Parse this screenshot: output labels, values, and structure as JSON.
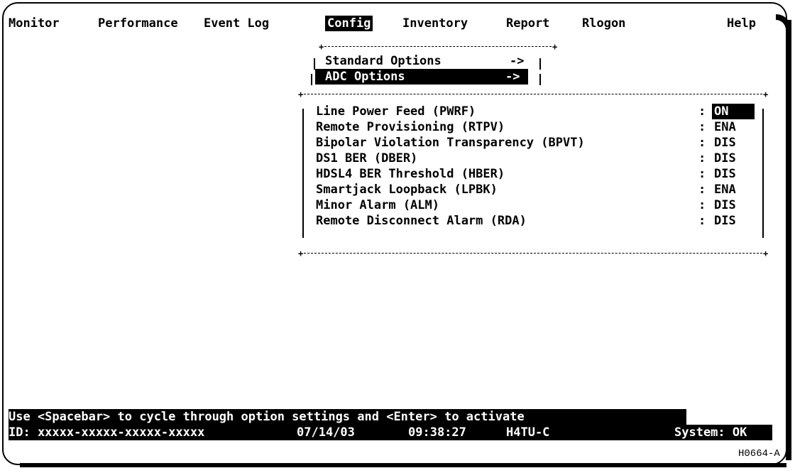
{
  "menubar": {
    "items": [
      "Monitor",
      "Performance",
      "Event Log",
      "Config",
      "Inventory",
      "Report",
      "Rlogon"
    ],
    "help": "Help",
    "active": "Config"
  },
  "submenu": {
    "items": [
      {
        "label": "Standard Options",
        "arrow": "->"
      },
      {
        "label": "ADC Options",
        "arrow": "->"
      }
    ],
    "selected_index": 1
  },
  "options": {
    "rows": [
      {
        "label": "Line Power Feed (PWRF)",
        "value": "ON",
        "selected": true
      },
      {
        "label": "Remote Provisioning (RTPV)",
        "value": "ENA"
      },
      {
        "label": "Bipolar Violation Transparency (BPVT)",
        "value": "DIS"
      },
      {
        "label": "DS1 BER (DBER)",
        "value": "DIS"
      },
      {
        "label": "HDSL4 BER Threshold (HBER)",
        "value": "DIS"
      },
      {
        "label": "Smartjack Loopback (LPBK)",
        "value": "ENA"
      },
      {
        "label": "Minor Alarm (ALM)",
        "value": "DIS"
      },
      {
        "label": "Remote Disconnect Alarm (RDA)",
        "value": "DIS"
      }
    ],
    "separator": ":"
  },
  "hint": "Use <Spacebar> to cycle through option settings and <Enter> to activate",
  "status": {
    "id": "ID: xxxxx-xxxxx-xxxxx-xxxxx",
    "date": "07/14/03",
    "time": "09:38:27",
    "unit": "H4TU-C",
    "system": "System: OK"
  },
  "figure_id": "H0664-A"
}
